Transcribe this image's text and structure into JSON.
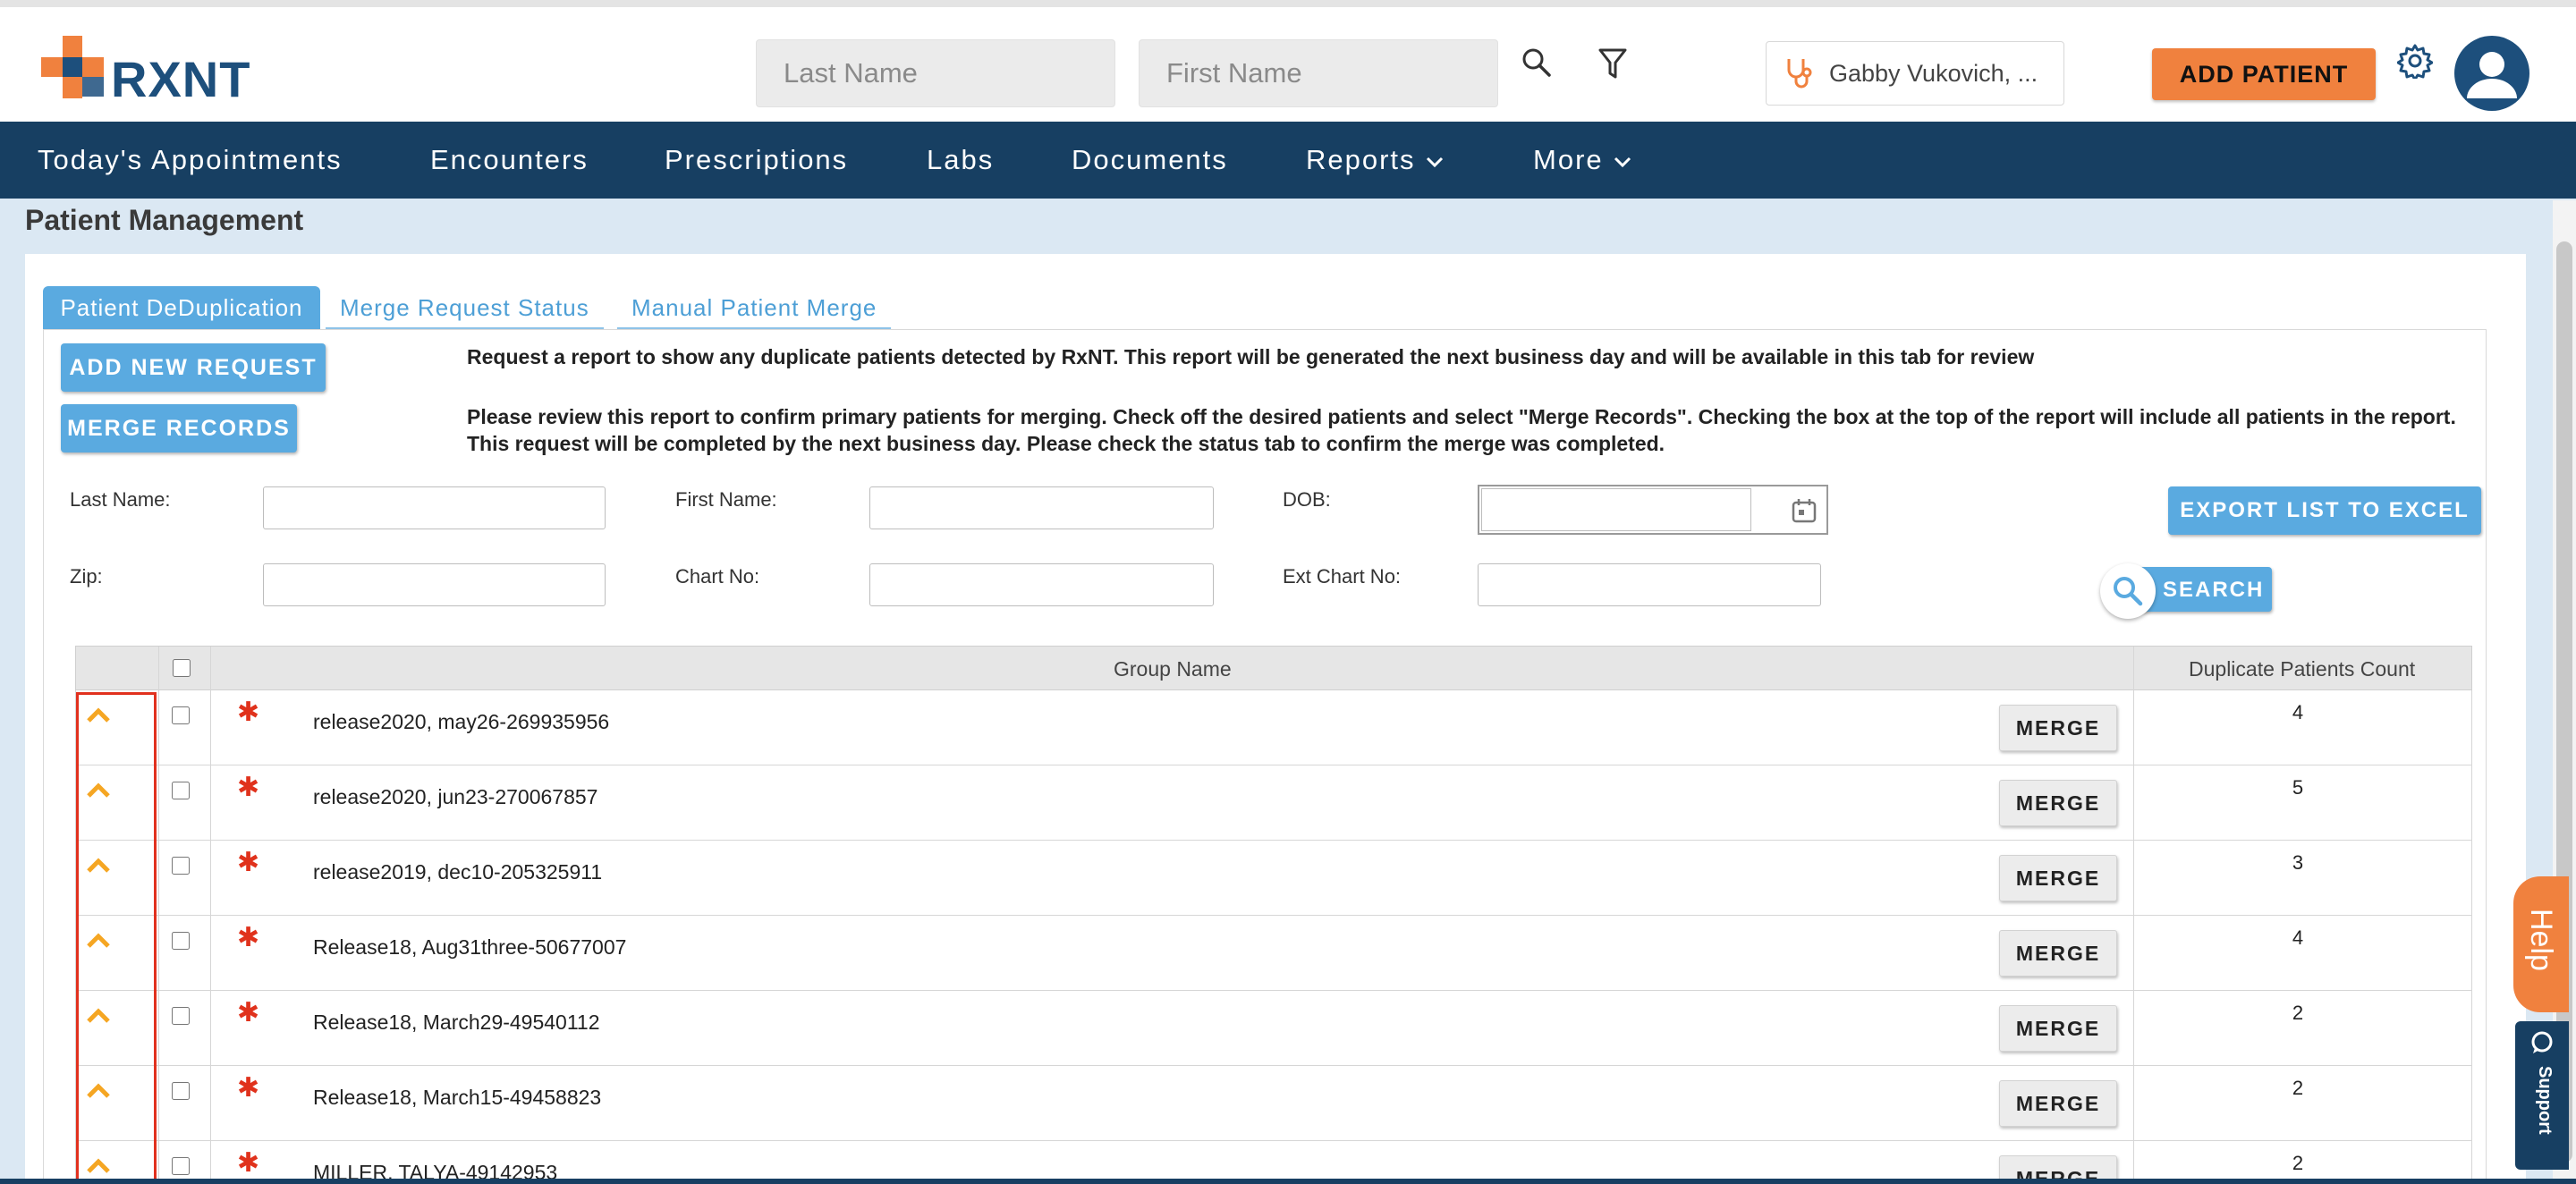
{
  "brand": {
    "name": "RXNT",
    "orange": "#f0813e",
    "navy": "#173f62",
    "blue": "#5aaae0"
  },
  "header": {
    "last_name_placeholder": "Last Name",
    "first_name_placeholder": "First Name",
    "provider": "Gabby Vukovich, ...",
    "add_patient": "ADD PATIENT",
    "icons": [
      "search-icon",
      "filter-icon",
      "stethoscope-icon",
      "gear-icon",
      "user-avatar-icon"
    ]
  },
  "nav": {
    "items": [
      "Today's Appointments",
      "Encounters",
      "Prescriptions",
      "Labs",
      "Documents",
      "Reports",
      "More"
    ]
  },
  "page": {
    "title": "Patient Management"
  },
  "tabs": [
    "Patient DeDuplication",
    "Merge Request Status",
    "Manual Patient Merge"
  ],
  "actions": {
    "add_new_request": "ADD NEW REQUEST",
    "merge_records": "MERGE RECORDS"
  },
  "info": {
    "line1": "Request a report to show any duplicate patients detected by RxNT. This report will be generated the next business day and will be available in this tab for review",
    "line2": "Please review this report to confirm primary patients for merging. Check off the desired patients and select \"Merge Records\". Checking the box at the top of the report will include all patients in the report.",
    "line3": "This request will be completed by the next business day. Please check the status tab to confirm the merge was completed."
  },
  "filters": {
    "last_name": "Last Name:",
    "first_name": "First Name:",
    "dob": "DOB:",
    "zip": "Zip:",
    "chart_no": "Chart No:",
    "ext_chart_no": "Ext Chart No:",
    "export": "EXPORT LIST TO EXCEL",
    "search": "SEARCH"
  },
  "table": {
    "columns": [
      "Group Name",
      "Duplicate Patients Count"
    ],
    "merge_label": "MERGE",
    "rows": [
      {
        "group": "release2020, may26-269935956",
        "count": "4"
      },
      {
        "group": "release2020, jun23-270067857",
        "count": "5"
      },
      {
        "group": "release2019, dec10-205325911",
        "count": "3"
      },
      {
        "group": "Release18, Aug31three-50677007",
        "count": "4"
      },
      {
        "group": "Release18, March29-49540112",
        "count": "2"
      },
      {
        "group": "Release18, March15-49458823",
        "count": "2"
      },
      {
        "group": "MILLER, TALYA-49142953",
        "count": "2"
      }
    ]
  },
  "help": {
    "help": "Help",
    "support": "Support"
  }
}
